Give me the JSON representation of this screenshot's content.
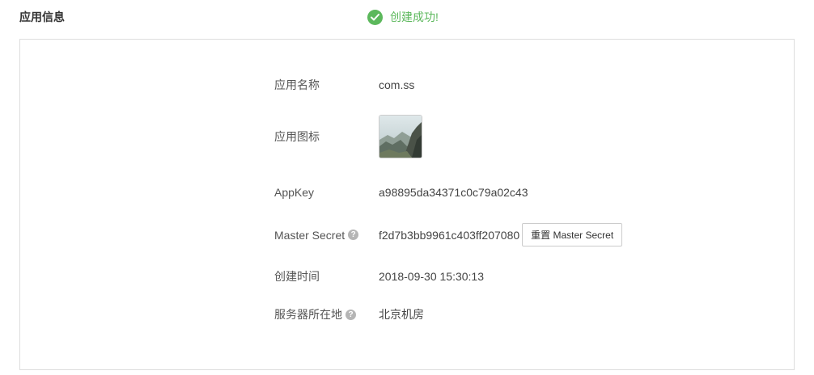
{
  "header": {
    "title": "应用信息"
  },
  "toast": {
    "message": "创建成功!",
    "color": "#5cb85c",
    "icon": "check-circle-icon"
  },
  "app_info": {
    "name": {
      "label": "应用名称",
      "value": "com.ss"
    },
    "icon": {
      "label": "应用图标",
      "image": "mountain-landscape-thumbnail"
    },
    "appkey": {
      "label": "AppKey",
      "value": "a98895da34371c0c79a02c43"
    },
    "master_secret": {
      "label": "Master Secret",
      "value": "f2d7b3bb9961c403ff207080",
      "reset_button": "重置 Master Secret",
      "help": "?"
    },
    "created_time": {
      "label": "创建时间",
      "value": "2018-09-30 15:30:13"
    },
    "server_location": {
      "label": "服务器所在地",
      "value": "北京机房",
      "help": "?"
    }
  }
}
